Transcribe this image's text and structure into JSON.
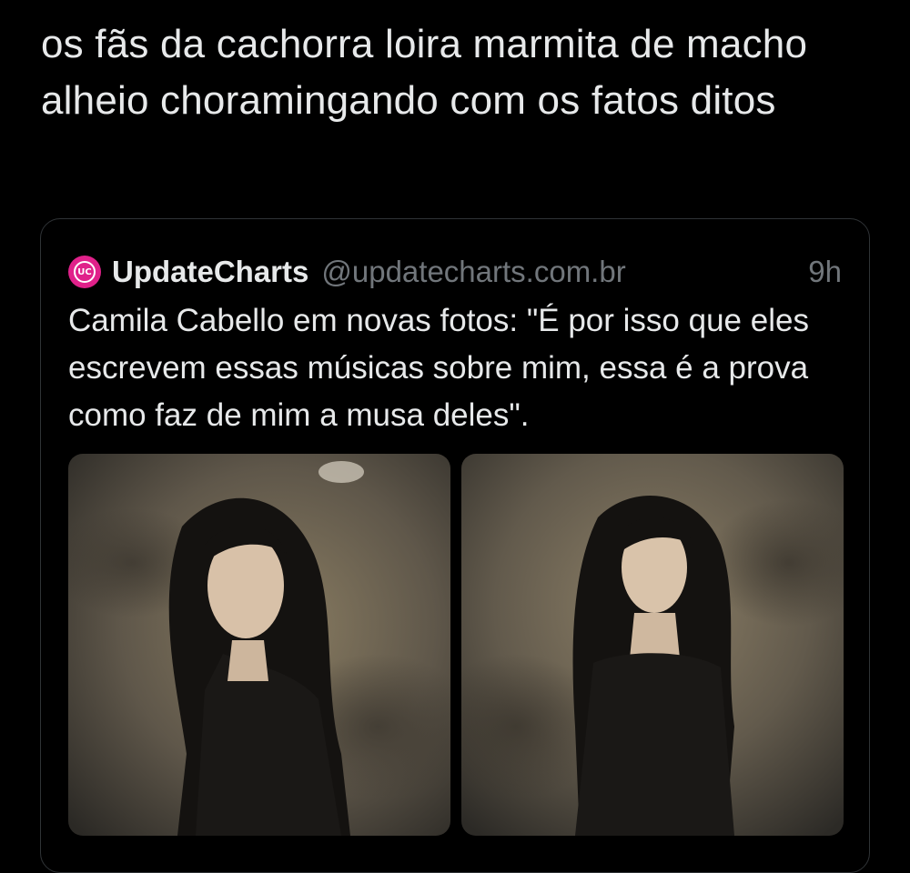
{
  "tweet": {
    "text": "os fãs da cachorra loira marmita de macho alheio choramingando com os fatos ditos"
  },
  "quote": {
    "display_name": "UpdateCharts",
    "handle": "@updatecharts.com.br",
    "time": "9h",
    "text": "Camila Cabello em novas fotos: \"É por isso que eles escrevem essas músicas sobre mim, essa é a prova como faz de mim a musa deles\".",
    "avatar_color": "#e0218a",
    "avatar_icon": "uc-logo-icon",
    "media": [
      {
        "description": "photo-1"
      },
      {
        "description": "photo-2"
      }
    ]
  },
  "colors": {
    "background": "#000000",
    "text": "#e7e9ea",
    "secondary_text": "#71767b",
    "border": "#2f3336"
  }
}
